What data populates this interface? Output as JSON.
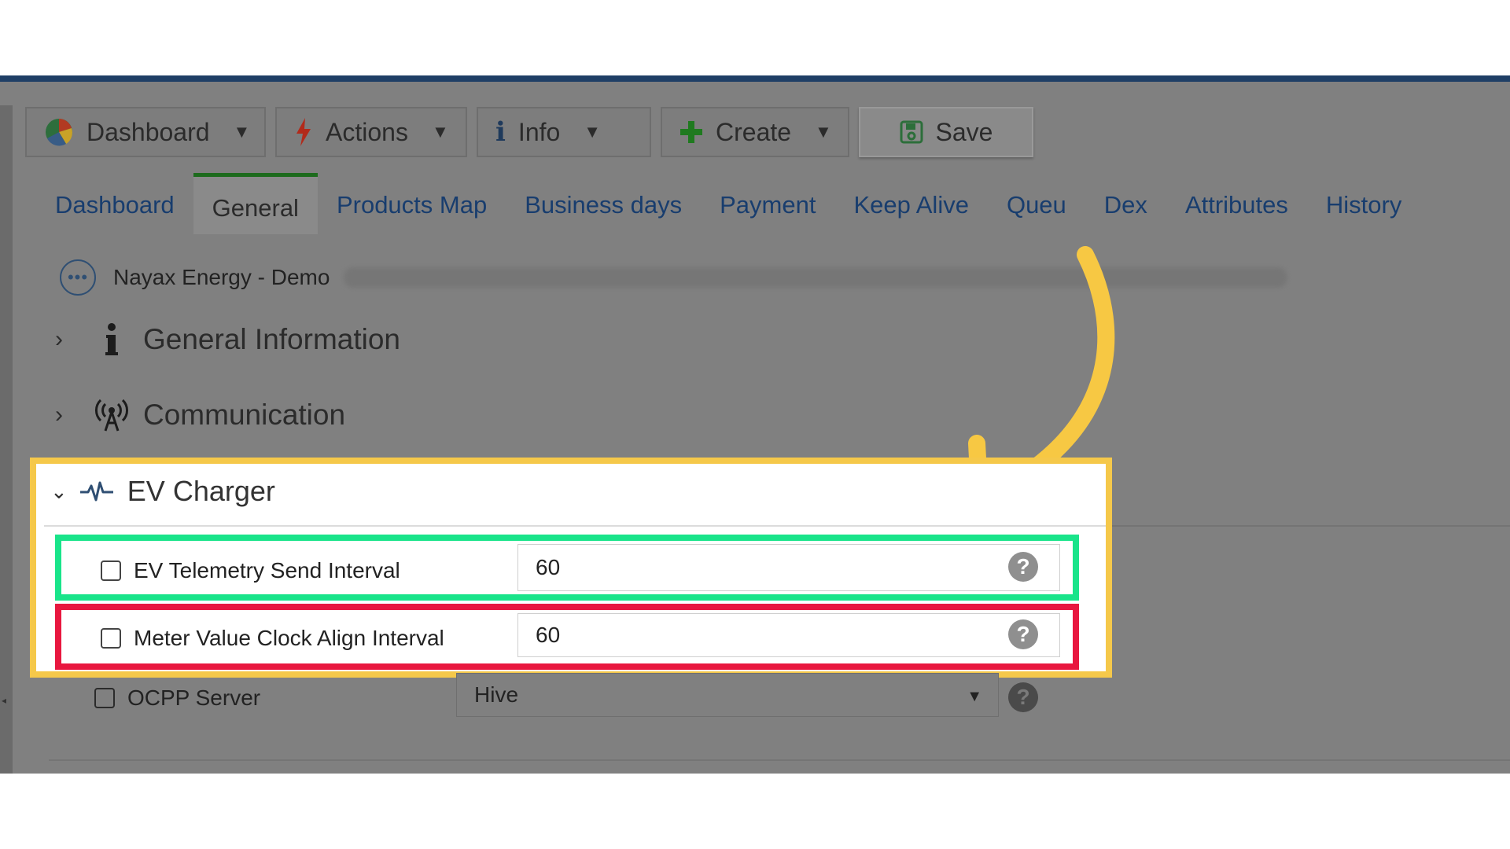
{
  "toolbar": {
    "dashboard_label": "Dashboard",
    "actions_label": "Actions",
    "info_label": "Info",
    "create_label": "Create",
    "save_label": "Save"
  },
  "tabs": [
    "Dashboard",
    "General",
    "Products Map",
    "Business days",
    "Payment",
    "Keep Alive",
    "Queu",
    "Dex",
    "Attributes",
    "History"
  ],
  "active_tab": "General",
  "breadcrumb": {
    "device_name": "Nayax Energy - Demo"
  },
  "sections": {
    "general_information": "General Information",
    "communication": "Communication",
    "ev_charger": "EV Charger"
  },
  "fields": {
    "ev_telemetry": {
      "label": "EV Telemetry Send Interval",
      "value": "60"
    },
    "meter_value": {
      "label": "Meter Value Clock Align Interval",
      "value": "60"
    },
    "ocpp_server": {
      "label": "OCPP Server",
      "value": "Hive"
    }
  },
  "icons": {
    "help": "?",
    "info": "i"
  },
  "colors": {
    "highlight_yellow": "#f5c84a",
    "highlight_green": "#19e48a",
    "highlight_red": "#e8173f",
    "tab_link": "#183d6e",
    "top_line": "#1f3f66"
  }
}
